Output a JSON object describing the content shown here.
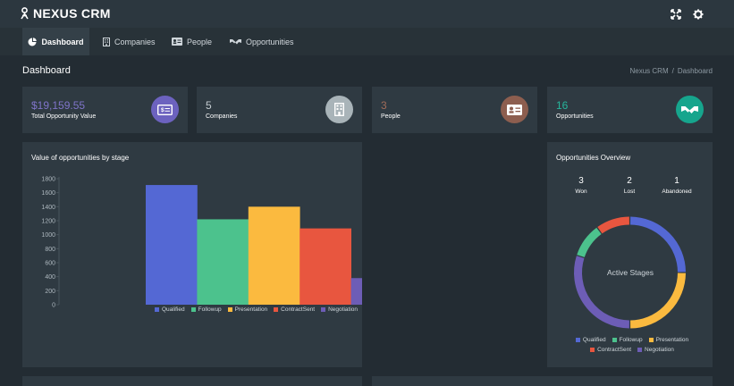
{
  "app": {
    "name": "NEXUS CRM"
  },
  "topbar": {
    "fullscreen_icon": "fullscreen-icon",
    "settings_icon": "gear-icon"
  },
  "nav": {
    "tabs": [
      {
        "label": "Dashboard",
        "icon": "pie-chart-icon",
        "active": true
      },
      {
        "label": "Companies",
        "icon": "building-icon",
        "active": false
      },
      {
        "label": "People",
        "icon": "id-card-icon",
        "active": false
      },
      {
        "label": "Opportunities",
        "icon": "handshake-icon",
        "active": false
      }
    ]
  },
  "page": {
    "title": "Dashboard",
    "breadcrumb": {
      "root": "Nexus CRM",
      "separator": "/",
      "current": "Dashboard"
    }
  },
  "stats": [
    {
      "value": "$19,159.55",
      "label": "Total Opportunity Value",
      "icon": "money-icon",
      "value_color": "#7f74c9",
      "icon_bg": "#6c62bf"
    },
    {
      "value": "5",
      "label": "Companies",
      "icon": "building-icon",
      "value_color": "#c4ccd1",
      "icon_bg": "#a9b4b9"
    },
    {
      "value": "3",
      "label": "People",
      "icon": "id-card-icon",
      "value_color": "#a06c59",
      "icon_bg": "#8d5e4f"
    },
    {
      "value": "16",
      "label": "Opportunities",
      "icon": "handshake-icon",
      "value_color": "#26b59c",
      "icon_bg": "#16a58d"
    }
  ],
  "bar_card": {
    "title": "Value of opportunities by stage"
  },
  "donut_card": {
    "title": "Opportunities Overview",
    "summary": [
      {
        "value": "3",
        "label": "Won"
      },
      {
        "value": "2",
        "label": "Lost"
      },
      {
        "value": "1",
        "label": "Abandoned"
      }
    ],
    "center_label": "Active Stages"
  },
  "chart_data": [
    {
      "type": "bar",
      "title": "Value of opportunities by stage",
      "categories": [
        "Qualified",
        "Followup",
        "Presentation",
        "ContractSent",
        "Negotiation"
      ],
      "values": [
        1710,
        1220,
        1400,
        1090,
        380
      ],
      "colors": [
        "#5468d4",
        "#4cc28d",
        "#fbba3f",
        "#e8563f",
        "#6d5db6"
      ],
      "ylim": [
        0,
        1800
      ],
      "yticks": [
        0,
        200,
        400,
        600,
        800,
        1000,
        1200,
        1400,
        1600,
        1800
      ],
      "legend": "bottom"
    },
    {
      "type": "pie",
      "title": "Active Stages",
      "categories": [
        "Qualified",
        "Followup",
        "Presentation",
        "ContractSent",
        "Negotiation"
      ],
      "values": [
        25,
        10,
        25,
        10,
        30
      ],
      "colors": [
        "#5468d4",
        "#4cc28d",
        "#fbba3f",
        "#e8563f",
        "#6d5db6"
      ],
      "legend": "bottom"
    }
  ]
}
